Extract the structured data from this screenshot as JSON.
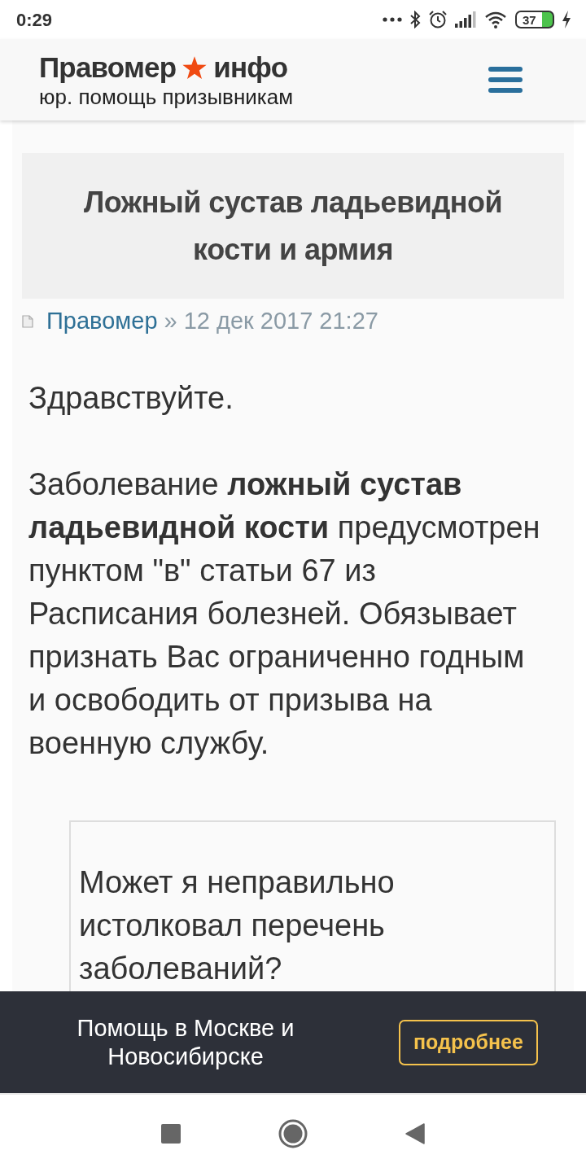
{
  "status_bar": {
    "time": "0:29",
    "battery": "37"
  },
  "header": {
    "logo_left": "Правомер",
    "logo_right": "инфо",
    "tagline": "юр. помощь призывникам"
  },
  "article": {
    "title": "Ложный сустав ладьевидной кости и армия",
    "author": "Правомер",
    "separator": "»",
    "date": "12 дек 2017 21:27",
    "paragraphs": [
      "Здравствуйте.",
      "Заболевание **ложный сустав ладьевидной кости** предусмотрен пунктом \"в\" статьи 67 из Расписания болезней. Обязывает признать Вас ограниченно годным и освободить от призыва на военную службу."
    ],
    "quote": "Может я неправильно истолковал перечень заболеваний?"
  },
  "banner": {
    "text": "Помощь в Москве и Новосибирске",
    "button": "подробнее"
  }
}
